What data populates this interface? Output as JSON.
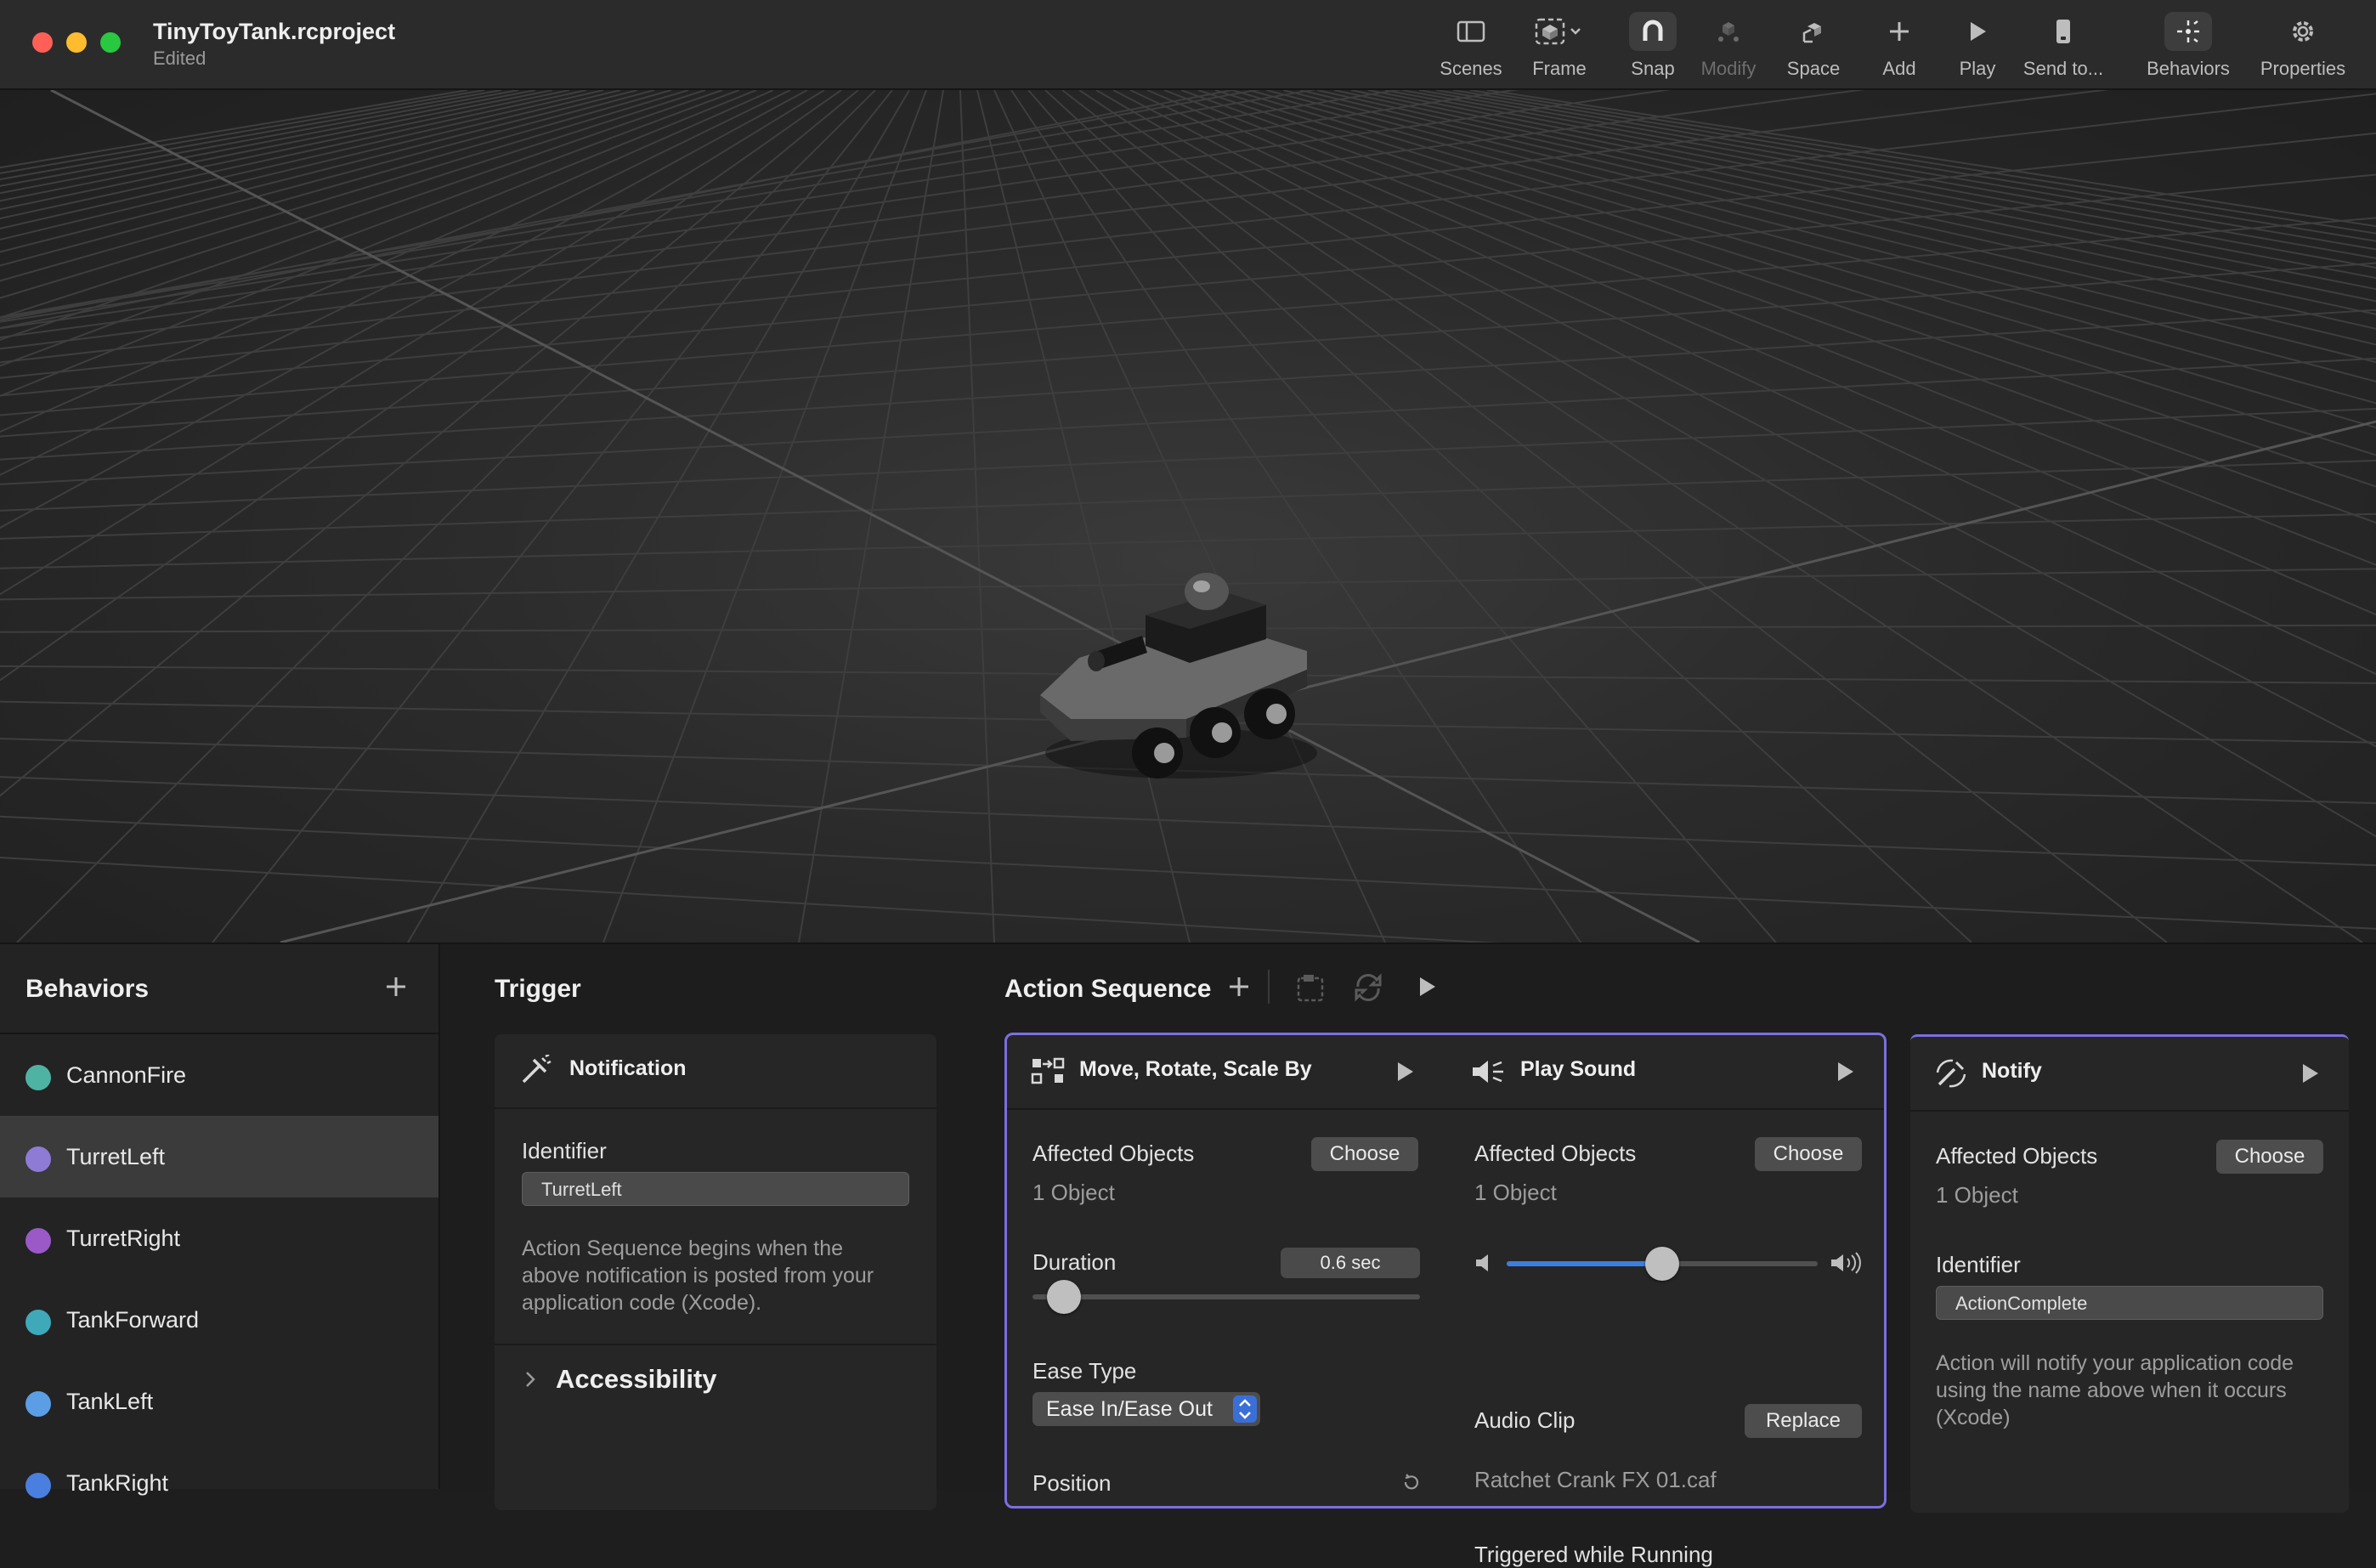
{
  "window": {
    "title": "TinyToyTank.rcproject",
    "subtitle": "Edited"
  },
  "toolbar": {
    "items": [
      {
        "label": "Scenes",
        "icon": "sidebar-icon",
        "enabled": true
      },
      {
        "label": "Frame",
        "icon": "frame-icon",
        "enabled": true
      },
      {
        "label": "Snap",
        "icon": "magnet-icon",
        "enabled": true,
        "active": true
      },
      {
        "label": "Modify",
        "icon": "modify-icon",
        "enabled": false
      },
      {
        "label": "Space",
        "icon": "space-icon",
        "enabled": true
      },
      {
        "label": "Add",
        "icon": "plus-icon",
        "enabled": true
      },
      {
        "label": "Play",
        "icon": "play-icon",
        "enabled": true
      },
      {
        "label": "Send to...",
        "icon": "phone-icon",
        "enabled": true
      },
      {
        "label": "Behaviors",
        "icon": "behaviors-icon",
        "enabled": true,
        "active": true
      },
      {
        "label": "Properties",
        "icon": "gear-icon",
        "enabled": true
      }
    ]
  },
  "behaviors": {
    "title": "Behaviors",
    "items": [
      {
        "label": "CannonFire",
        "color": "#4fb3a3"
      },
      {
        "label": "TurretLeft",
        "color": "#8e7bd6",
        "selected": true
      },
      {
        "label": "TurretRight",
        "color": "#9b59c8"
      },
      {
        "label": "TankForward",
        "color": "#3ea9b9"
      },
      {
        "label": "TankLeft",
        "color": "#5b9ee6"
      },
      {
        "label": "TankRight",
        "color": "#4a7fe0"
      }
    ]
  },
  "trigger": {
    "title": "Trigger",
    "card_title": "Notification",
    "identifier_label": "Identifier",
    "identifier_value": "TurretLeft",
    "description": "Action Sequence begins when the above notification is posted from your application code (Xcode).",
    "accessibility_label": "Accessibility"
  },
  "action_sequence": {
    "title": "Action Sequence",
    "move": {
      "title": "Move, Rotate, Scale By",
      "affected_label": "Affected Objects",
      "choose_label": "Choose",
      "affected_count": "1 Object",
      "duration_label": "Duration",
      "duration_value": "0.6 sec",
      "duration_fraction": 0.05,
      "ease_label": "Ease Type",
      "ease_value": "Ease In/Ease Out",
      "position_label": "Position"
    },
    "sound": {
      "title": "Play Sound",
      "affected_label": "Affected Objects",
      "choose_label": "Choose",
      "affected_count": "1 Object",
      "volume_fraction": 0.5,
      "audio_label": "Audio Clip",
      "replace_label": "Replace",
      "audio_file": "Ratchet Crank FX 01.caf",
      "triggered_label": "Triggered while Running"
    },
    "notify": {
      "title": "Notify",
      "affected_label": "Affected Objects",
      "choose_label": "Choose",
      "affected_count": "1 Object",
      "identifier_label": "Identifier",
      "identifier_value": "ActionComplete",
      "description": "Action will notify your application code using the name above when it occurs (Xcode)"
    }
  },
  "colors": {
    "accent": "#7b6fe0",
    "selection": "#3b3b3b",
    "stepper": "#3b6fd8"
  }
}
